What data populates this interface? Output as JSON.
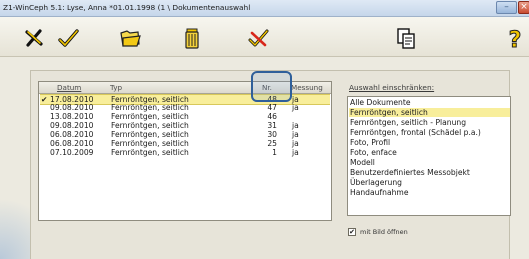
{
  "window": {
    "title": "Z1-WinCeph 5.1: Lyse, Anna *01.01.1998 (1 \\ Dokumentenauswahl",
    "minimize_glyph": "–",
    "close_glyph": "×"
  },
  "toolbar": {
    "icons": [
      "cross-icon",
      "checkmark-icon",
      "folder-open-icon",
      "trash-bin-icon",
      "no-checkmark-icon",
      "document-copy-icon",
      "help-icon"
    ]
  },
  "documents_table": {
    "headers": {
      "datum": "Datum",
      "typ": "Typ",
      "nr": "Nr.",
      "messung": "Messung"
    },
    "rows": [
      {
        "checked": "✔",
        "date": "17.08.2010",
        "type": "Fernröntgen, seitlich",
        "nr": "48",
        "messung": "ja"
      },
      {
        "checked": "",
        "date": "09.08.2010",
        "type": "Fernröntgen, seitlich",
        "nr": "47",
        "messung": "ja"
      },
      {
        "checked": "",
        "date": "13.08.2010",
        "type": "Fernröntgen, seitlich",
        "nr": "46",
        "messung": ""
      },
      {
        "checked": "",
        "date": "09.08.2010",
        "type": "Fernröntgen, seitlich",
        "nr": "31",
        "messung": "ja"
      },
      {
        "checked": "",
        "date": "06.08.2010",
        "type": "Fernröntgen, seitlich",
        "nr": "30",
        "messung": "ja"
      },
      {
        "checked": "",
        "date": "06.08.2010",
        "type": "Fernröntgen, seitlich",
        "nr": "25",
        "messung": "ja"
      },
      {
        "checked": "",
        "date": "07.10.2009",
        "type": "Fernröntgen, seitlich",
        "nr": "1",
        "messung": "ja"
      }
    ]
  },
  "filter": {
    "label": "Auswahl einschränken:",
    "items": [
      "Alle Dokumente",
      "Fernröntgen, seitlich",
      "Fernröntgen, seitlich - Planung",
      "Fernröntgen, frontal (Schädel p.a.)",
      "Foto, Profil",
      "Foto, enface",
      "Modell",
      "Benutzerdefiniertes Messobjekt",
      "Überlagerung",
      "Handaufnahme"
    ]
  },
  "open_with_image": {
    "checked": "✔",
    "label": "mit Bild öffnen"
  }
}
